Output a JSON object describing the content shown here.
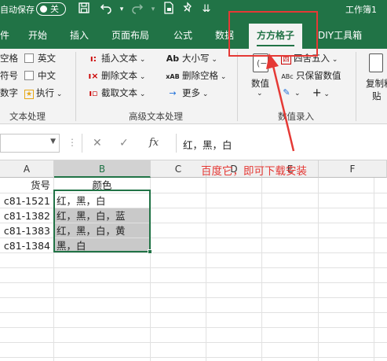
{
  "titlebar": {
    "autosave_label": "自动保存",
    "autosave_state": "关",
    "workbook_title": "工作簿1",
    "bg_color": "#217346"
  },
  "tabs": [
    {
      "label": "件"
    },
    {
      "label": "开始"
    },
    {
      "label": "插入"
    },
    {
      "label": "页面布局"
    },
    {
      "label": "公式"
    },
    {
      "label": "数据"
    },
    {
      "label": "方方格子",
      "active": true
    },
    {
      "label": "DIY工具箱"
    }
  ],
  "ribbon": {
    "text_processing": {
      "items": [
        "空格",
        "符号",
        "数字"
      ],
      "checkboxes": [
        "英文",
        "中文"
      ],
      "execute": "执行",
      "group_label": "文本处理"
    },
    "advanced_text": {
      "insert_text": "插入文本",
      "delete_text": "删除文本",
      "extract_text": "截取文本",
      "case": "大小写",
      "delete_spaces": "删除空格",
      "more": "更多",
      "group_label": "高级文本处理"
    },
    "numeric_entry": {
      "value": "数值",
      "round": "四舍五入",
      "keep_value": "只保留数值",
      "group_label": "数值录入"
    },
    "paste": {
      "copy_label": "复制粘",
      "paste_label": "贴"
    }
  },
  "formula_bar": {
    "fx": "fx",
    "content": "红，黑，白"
  },
  "grid": {
    "columns": [
      "A",
      "B",
      "C",
      "D",
      "E",
      "F"
    ],
    "selected_column": "B",
    "header_row": {
      "a": "货号",
      "b": "颜色"
    },
    "rows": [
      {
        "a": "c81-1521",
        "b": "红，黑，白"
      },
      {
        "a": "c81-1382",
        "b": "红，黑，白，蓝"
      },
      {
        "a": "c81-1383",
        "b": "红，黑，白，黄"
      },
      {
        "a": "c81-1384",
        "b": "黑，白"
      }
    ]
  },
  "annotation": {
    "text": "百度它，即可下载安装",
    "color": "#e53935"
  }
}
